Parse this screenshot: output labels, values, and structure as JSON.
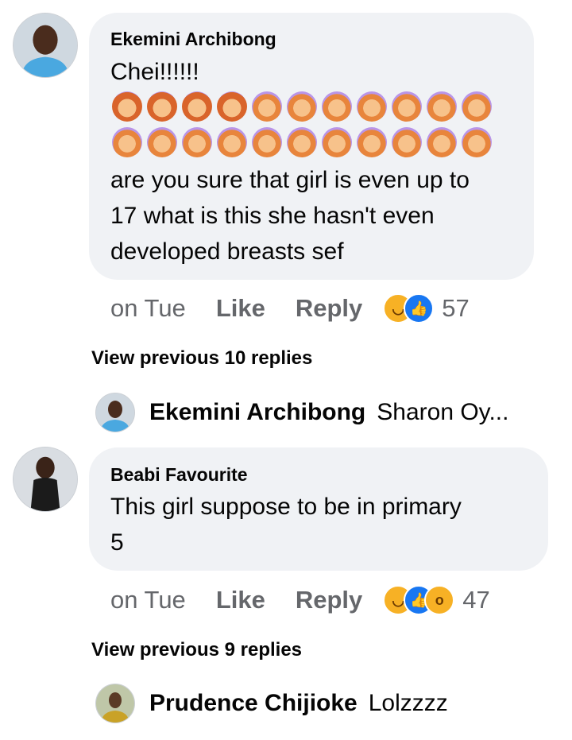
{
  "comments": [
    {
      "author": "Ekemini Archibong",
      "text_line1": "Chei!!!!!!",
      "emoji_rows": [
        [
          "facepalm",
          "facepalm",
          "facepalm",
          "facepalm",
          "arms-up",
          "arms-up",
          "arms-up",
          "arms-up",
          "arms-up",
          "arms-up",
          "arms-up"
        ],
        [
          "arms-up",
          "arms-up",
          "arms-up",
          "arms-up",
          "arms-up",
          "arms-up",
          "arms-up",
          "arms-up",
          "arms-up",
          "arms-up",
          "arms-up"
        ]
      ],
      "text_rest": [
        "are you sure that girl is even up to",
        "17 what is this she hasn't even",
        "developed breasts sef"
      ],
      "time": "on Tue",
      "like": "Like",
      "reply": "Reply",
      "reaction_count": "57",
      "view_previous": "View previous 10 replies",
      "last_reply": {
        "author": "Ekemini Archibong",
        "snippet": "Sharon Oy..."
      }
    },
    {
      "author": "Beabi Favourite",
      "text": [
        "This  girl  suppose to be in  primary",
        "5"
      ],
      "time": "on Tue",
      "like": "Like",
      "reply": "Reply",
      "reaction_count": "47",
      "view_previous": "View previous 9 replies",
      "last_reply": {
        "author": "Prudence Chijioke",
        "snippet": "Lolzzzz"
      }
    }
  ],
  "colors": {
    "bubble": "#f0f2f5",
    "meta": "#65676b",
    "like_blue": "#1877f2",
    "haha_yellow": "#f7b125"
  }
}
